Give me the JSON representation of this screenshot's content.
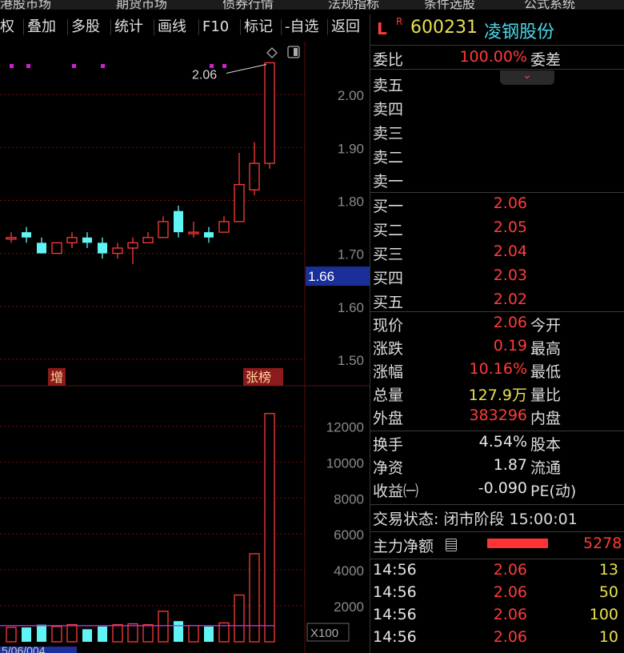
{
  "top_strip": [
    "港股市场",
    "期货市场",
    "债券行情",
    "法规指标",
    "条件选股",
    "公式系统"
  ],
  "toolbar": [
    "权",
    "叠加",
    "多股",
    "统计",
    "画线",
    "F10",
    "标记",
    "-自选",
    "返回"
  ],
  "chart_icons": [
    "diamond-icon",
    "panel-toggle-icon"
  ],
  "chart_data": [
    {
      "type": "candlestick",
      "y_ticks": [
        "2.00",
        "1.90",
        "1.80",
        "1.70",
        "1.60",
        "1.50"
      ],
      "ylim": [
        1.45,
        2.1
      ],
      "current_price_label": "1.66",
      "high_label": "2.06",
      "markers": [
        "增",
        "张榜"
      ],
      "candles": [
        {
          "o": 1.73,
          "h": 1.74,
          "l": 1.72,
          "c": 1.73
        },
        {
          "o": 1.74,
          "h": 1.75,
          "l": 1.72,
          "c": 1.73
        },
        {
          "o": 1.72,
          "h": 1.73,
          "l": 1.7,
          "c": 1.7
        },
        {
          "o": 1.7,
          "h": 1.72,
          "l": 1.7,
          "c": 1.72
        },
        {
          "o": 1.72,
          "h": 1.74,
          "l": 1.71,
          "c": 1.73
        },
        {
          "o": 1.73,
          "h": 1.74,
          "l": 1.71,
          "c": 1.72
        },
        {
          "o": 1.72,
          "h": 1.73,
          "l": 1.69,
          "c": 1.7
        },
        {
          "o": 1.7,
          "h": 1.72,
          "l": 1.69,
          "c": 1.71
        },
        {
          "o": 1.71,
          "h": 1.73,
          "l": 1.68,
          "c": 1.72
        },
        {
          "o": 1.72,
          "h": 1.74,
          "l": 1.72,
          "c": 1.73
        },
        {
          "o": 1.73,
          "h": 1.77,
          "l": 1.73,
          "c": 1.76
        },
        {
          "o": 1.78,
          "h": 1.79,
          "l": 1.73,
          "c": 1.74
        },
        {
          "o": 1.74,
          "h": 1.76,
          "l": 1.73,
          "c": 1.74
        },
        {
          "o": 1.74,
          "h": 1.75,
          "l": 1.72,
          "c": 1.73
        },
        {
          "o": 1.74,
          "h": 1.77,
          "l": 1.74,
          "c": 1.76
        },
        {
          "o": 1.76,
          "h": 1.89,
          "l": 1.76,
          "c": 1.83
        },
        {
          "o": 1.82,
          "h": 1.91,
          "l": 1.81,
          "c": 1.87
        },
        {
          "o": 1.87,
          "h": 2.06,
          "l": 1.86,
          "c": 2.06
        }
      ]
    },
    {
      "type": "bar",
      "y_ticks": [
        "12000",
        "10000",
        "8000",
        "6000",
        "4000",
        "2000"
      ],
      "ylim": [
        0,
        13800
      ],
      "unit_label": "X100",
      "values": [
        800,
        800,
        950,
        850,
        950,
        700,
        850,
        950,
        1000,
        950,
        1700,
        1150,
        900,
        850,
        1050,
        2600,
        4900,
        12700
      ]
    }
  ],
  "stock": {
    "code": "600231",
    "name": "凌钢股份",
    "badge_l": "L",
    "badge_r": "R"
  },
  "weibi": {
    "label": "委比",
    "value": "100.00%",
    "label2": "委差"
  },
  "asks": [
    {
      "label": "卖五"
    },
    {
      "label": "卖四"
    },
    {
      "label": "卖三"
    },
    {
      "label": "卖二"
    },
    {
      "label": "卖一"
    }
  ],
  "bids": [
    {
      "label": "买一",
      "price": "2.06"
    },
    {
      "label": "买二",
      "price": "2.05"
    },
    {
      "label": "买三",
      "price": "2.04"
    },
    {
      "label": "买四",
      "price": "2.03"
    },
    {
      "label": "买五",
      "price": "2.02"
    }
  ],
  "quote": [
    {
      "label": "现价",
      "value": "2.06",
      "label2": "今开",
      "color": "red"
    },
    {
      "label": "涨跌",
      "value": "0.19",
      "label2": "最高",
      "color": "red"
    },
    {
      "label": "涨幅",
      "value": "10.16%",
      "label2": "最低",
      "color": "red"
    },
    {
      "label": "总量",
      "value": "127.9万",
      "label2": "量比",
      "color": "yel"
    },
    {
      "label": "外盘",
      "value": "383296",
      "label2": "内盘",
      "color": "red"
    }
  ],
  "fundamentals": [
    {
      "label": "换手",
      "value": "4.54%",
      "label2": "股本"
    },
    {
      "label": "净资",
      "value": "1.87",
      "label2": "流通"
    },
    {
      "label": "收益㈠",
      "value": "-0.090",
      "label2": "PE(动)"
    }
  ],
  "trade_status": "交易状态: 闭市阶段 15:00:01",
  "main_force": {
    "label": "主力净额",
    "value": "5278"
  },
  "ticks": [
    {
      "time": "14:56",
      "price": "2.06",
      "vol": "13"
    },
    {
      "time": "14:56",
      "price": "2.06",
      "vol": "50"
    },
    {
      "time": "14:56",
      "price": "2.06",
      "vol": "100"
    },
    {
      "time": "14:56",
      "price": "2.06",
      "vol": "10"
    }
  ],
  "bottom_labels": [
    "5/06/004"
  ]
}
